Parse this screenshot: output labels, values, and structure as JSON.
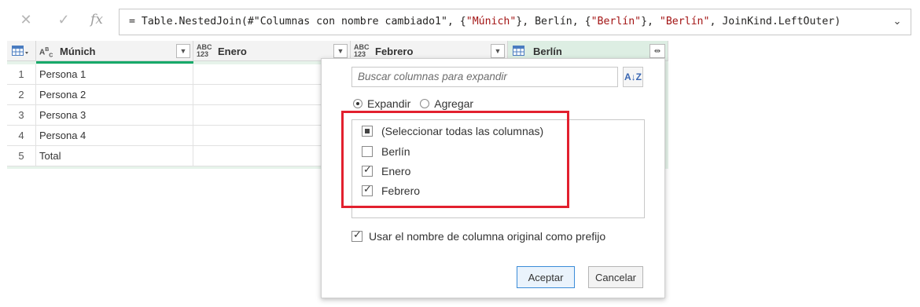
{
  "formula_bar": {
    "cancel_icon": "close-icon",
    "commit_icon": "check-icon",
    "fx_label": "fx",
    "formula_prefix": "= Table.NestedJoin(#\"Columnas con nombre cambiado1\", {",
    "formula_str1": "\"Múnich\"",
    "formula_mid1": "}, Berlín, {",
    "formula_str2": "\"Berlín\"",
    "formula_mid2": "}, ",
    "formula_str3": "\"Berlín\"",
    "formula_suffix": ", JoinKind.LeftOuter)",
    "expand_icon": "chevron-down-icon"
  },
  "table": {
    "columns": [
      {
        "type": "ABC",
        "name": "Múnich"
      },
      {
        "type": "ABC\n123",
        "name": "Enero"
      },
      {
        "type": "ABC\n123",
        "name": "Febrero"
      },
      {
        "type": "table",
        "name": "Berlín"
      }
    ],
    "rows": [
      {
        "num": "1",
        "munich": "Persona 1"
      },
      {
        "num": "2",
        "munich": "Persona 2"
      },
      {
        "num": "3",
        "munich": "Persona 3"
      },
      {
        "num": "4",
        "munich": "Persona 4"
      },
      {
        "num": "5",
        "munich": "Total"
      }
    ]
  },
  "expand_dialog": {
    "search_placeholder": "Buscar columnas para expandir",
    "mode_expand": "Expandir",
    "mode_aggregate": "Agregar",
    "mode_selected": "Expandir",
    "items": [
      {
        "label": "(Seleccionar todas las columnas)",
        "state": "partial"
      },
      {
        "label": "Berlín",
        "state": "unchecked"
      },
      {
        "label": "Enero",
        "state": "checked"
      },
      {
        "label": "Febrero",
        "state": "checked"
      }
    ],
    "prefix_label": "Usar el nombre de columna original como prefijo",
    "prefix_checked": true,
    "ok_label": "Aceptar",
    "cancel_label": "Cancelar"
  },
  "colors": {
    "highlight_border": "#e2202e",
    "selected_column": "#17a96a",
    "string_literal": "#a31515"
  }
}
